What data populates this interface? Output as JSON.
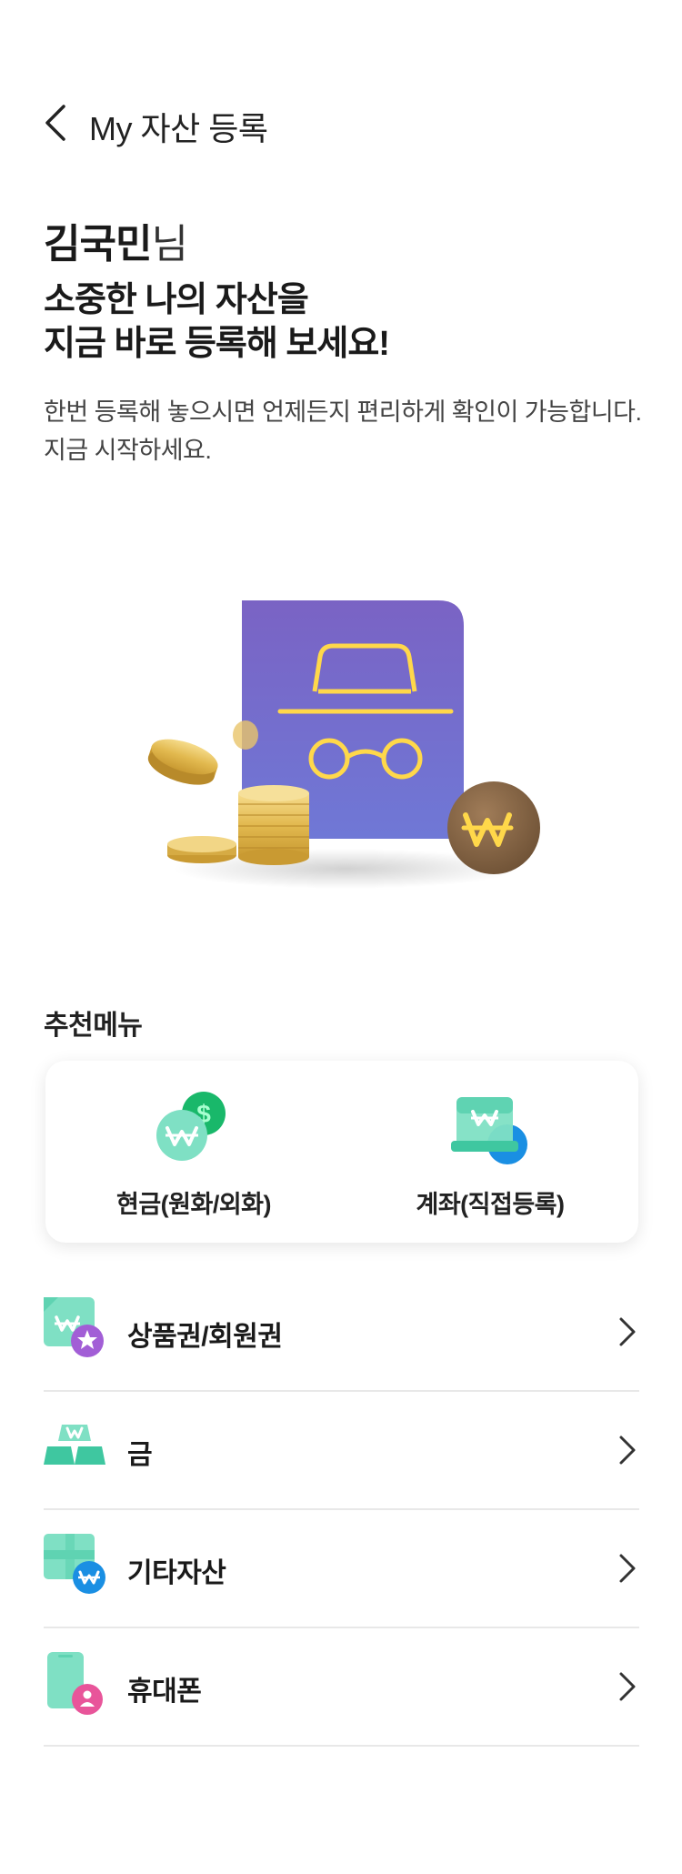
{
  "header": {
    "title": "My 자산 등록"
  },
  "greeting": {
    "name": "김국민",
    "suffix": "님"
  },
  "headline": {
    "line1": "소중한 나의 자산을",
    "line2": "지금 바로 등록해 보세요!"
  },
  "description": {
    "line1": "한번 등록해 놓으시면 언제든지 편리하게 확인이 가능합니다.",
    "line2": "지금 시작하세요."
  },
  "recommended": {
    "title": "추천메뉴",
    "items": [
      {
        "label": "현금(원화/외화)",
        "icon": "cash-won-dollar-icon"
      },
      {
        "label": "계좌(직접등록)",
        "icon": "account-wallet-icon"
      }
    ]
  },
  "list": [
    {
      "label": "상품권/회원권",
      "icon": "gift-card-icon"
    },
    {
      "label": "금",
      "icon": "gold-bars-icon"
    },
    {
      "label": "기타자산",
      "icon": "other-assets-icon"
    },
    {
      "label": "휴대폰",
      "icon": "phone-icon"
    }
  ],
  "colors": {
    "accent_green": "#3ec9a0",
    "card_purple": "#7868c9",
    "gold": "#e8c15a",
    "won_brown": "#8a6a4a",
    "blue": "#1a8fe3"
  }
}
